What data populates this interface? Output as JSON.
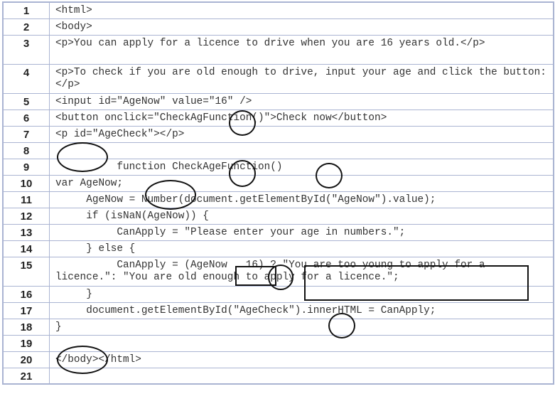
{
  "lines": [
    {
      "num": "1",
      "code": "<html>"
    },
    {
      "num": "2",
      "code": "<body>"
    },
    {
      "num": "3",
      "code": "<p>You can apply for a licence to drive when you are 16 years old.</p>"
    },
    {
      "num": "4",
      "code": "<p>To check if you are old enough to drive, input your age and click the button:</p>"
    },
    {
      "num": "5",
      "code": "<input id=\"AgeNow\" value=\"16\" />"
    },
    {
      "num": "6",
      "code": "<button onclick=\"CheckAgFunction()\">Check now</button>"
    },
    {
      "num": "7",
      "code": "<p id=\"AgeCheck\"></p>"
    },
    {
      "num": "8",
      "code": ""
    },
    {
      "num": "9",
      "code": "          function CheckAgeFunction()"
    },
    {
      "num": "10",
      "code": "var AgeNow;"
    },
    {
      "num": "11",
      "code": "     AgeNow = Number(document.getElementById(\"AgeNow\").value);"
    },
    {
      "num": "12",
      "code": "     if (isNaN(AgeNow)) {"
    },
    {
      "num": "13",
      "code": "          CanApply = \"Please enter your age in numbers.\";"
    },
    {
      "num": "14",
      "code": "     } else {"
    },
    {
      "num": "15",
      "code": "          CanApply = (AgeNow   16) ? \"You are too young to apply for a licence.\": \"You are old enough to apply for a licence.\";"
    },
    {
      "num": "16",
      "code": "     }"
    },
    {
      "num": "17",
      "code": "     document.getElementById(\"AgeCheck\").innerHTML = CanApply;"
    },
    {
      "num": "18",
      "code": "}"
    },
    {
      "num": "19",
      "code": ""
    },
    {
      "num": "20",
      "code": "</body></html>"
    },
    {
      "num": "21",
      "code": ""
    }
  ],
  "mark_color": "#111111",
  "grid_color": "#aab4d2"
}
